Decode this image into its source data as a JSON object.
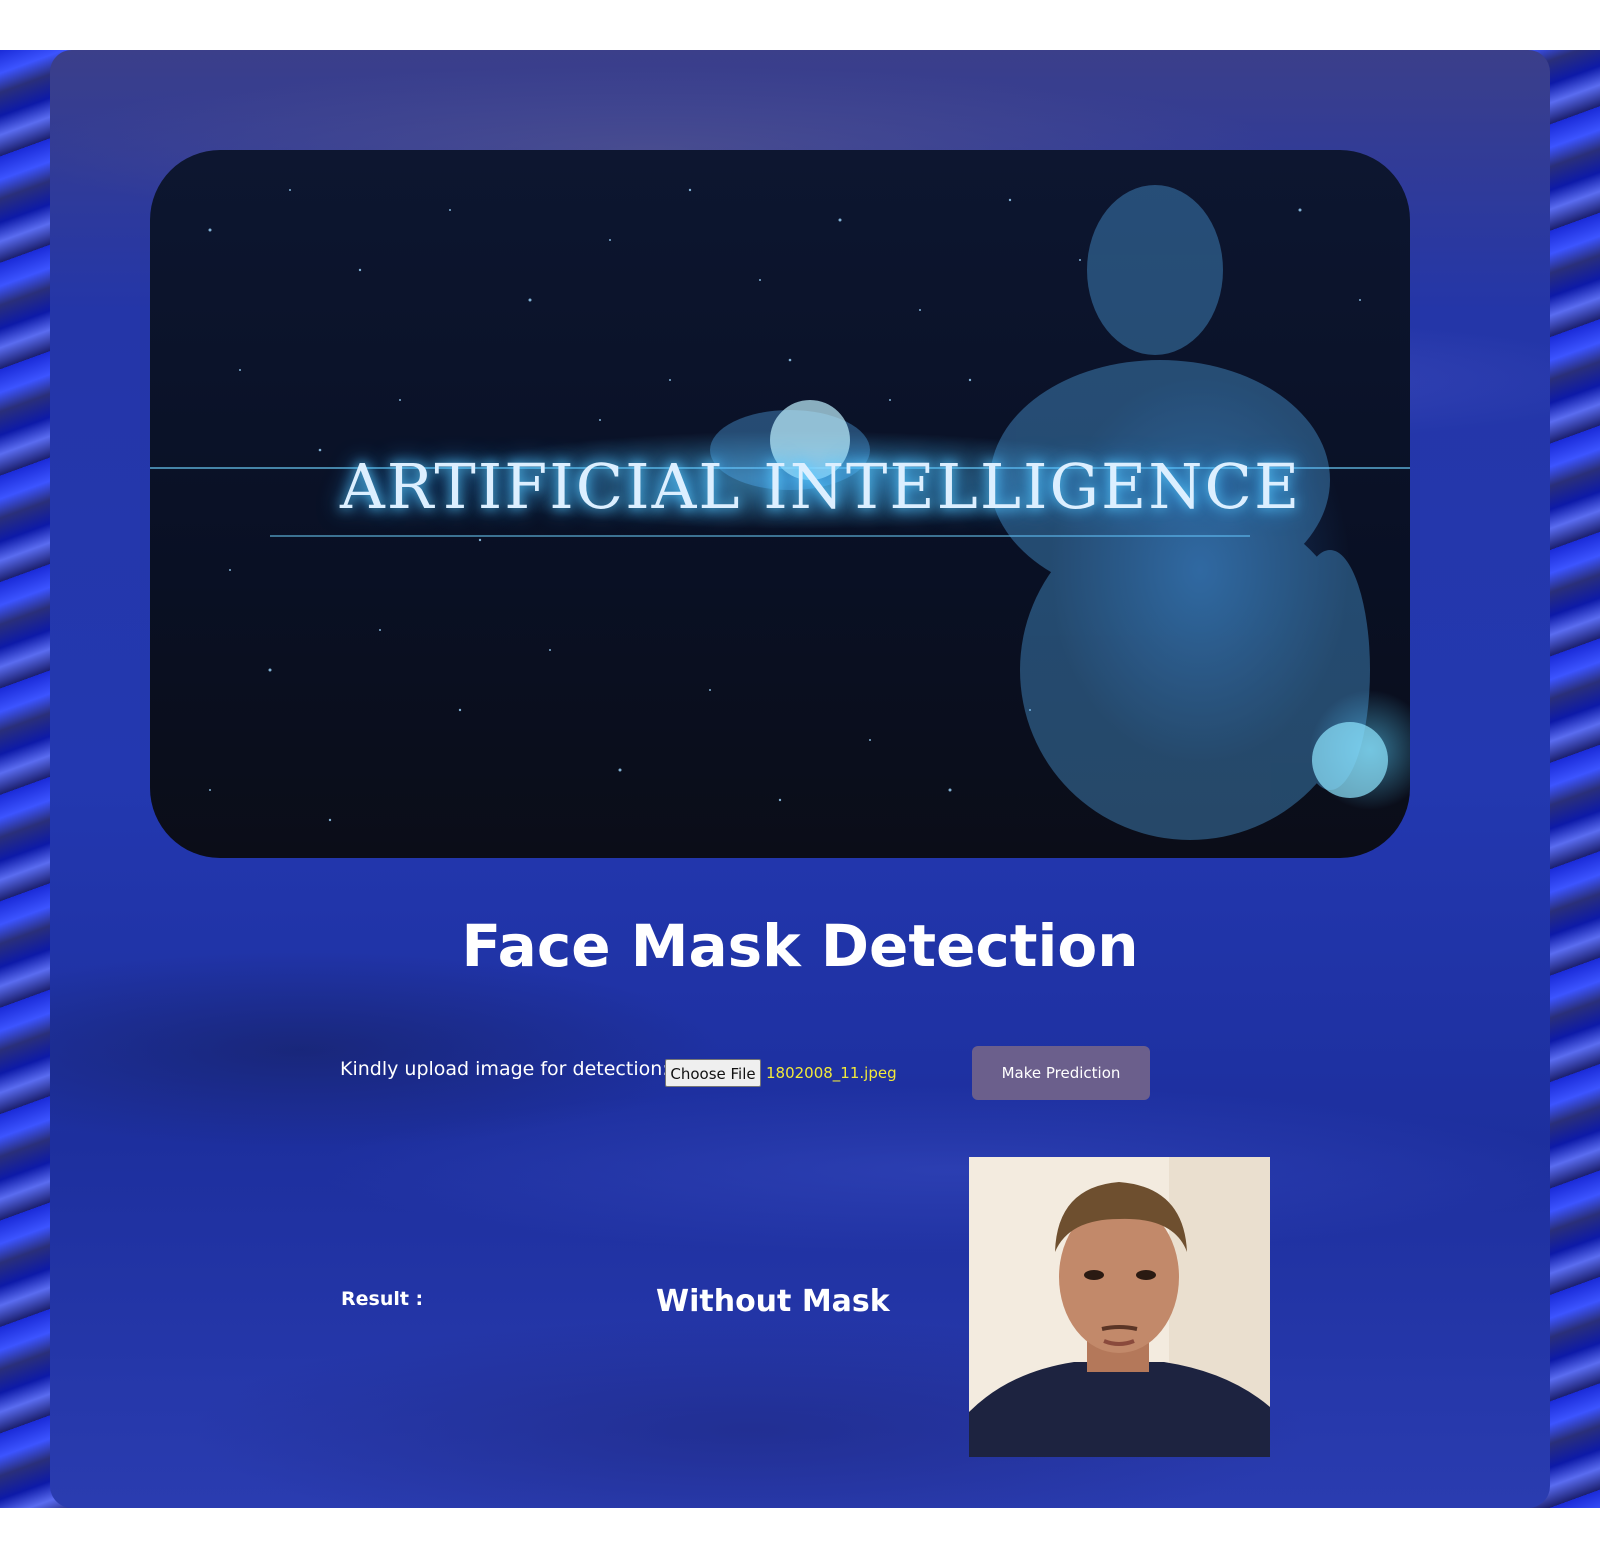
{
  "hero": {
    "banner_text": "ARTIFICIAL INTELLIGENCE"
  },
  "header": {
    "title": "Face Mask Detection"
  },
  "upload": {
    "label": "Kindly upload image for detection:",
    "choose_file_label": "Choose File",
    "selected_file": "1802008_11.jpeg",
    "predict_label": "Make Prediction"
  },
  "result": {
    "label": "Result :",
    "value": "Without Mask"
  },
  "colors": {
    "accent_button": "#6b5f8c",
    "file_name": "#f2e93a",
    "title": "#ffffff"
  }
}
